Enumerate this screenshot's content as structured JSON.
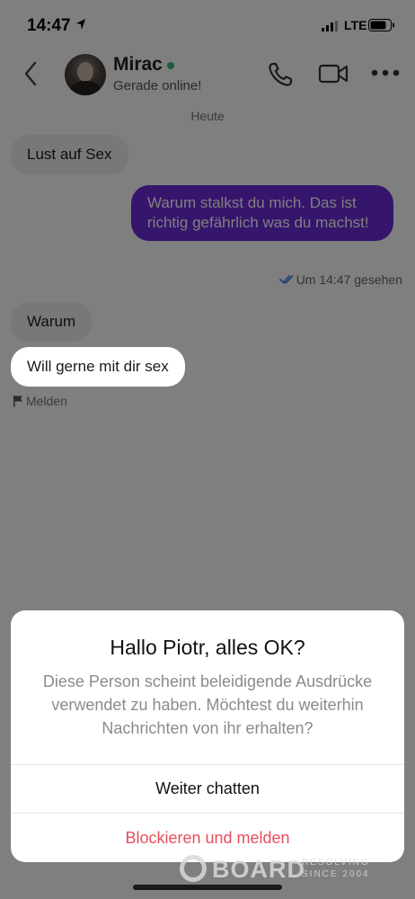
{
  "status_bar": {
    "time": "14:47",
    "network": "LTE"
  },
  "header": {
    "contact_name": "Mirac",
    "contact_status": "Gerade online!",
    "icons": [
      "chevron-left-icon",
      "phone-icon",
      "video-camera-icon",
      "more-icon"
    ]
  },
  "chat": {
    "day_label": "Heute",
    "messages": [
      {
        "direction": "incoming",
        "text": "Lust auf Sex"
      },
      {
        "direction": "outgoing",
        "text": "Warum stalkst du mich. Das ist richtig gefährlich was du machst!"
      },
      {
        "direction": "incoming",
        "text": "Warum"
      },
      {
        "direction": "incoming",
        "text": "Will gerne mit dir sex"
      }
    ],
    "seen_label": "Um 14:47 gesehen",
    "report_label": "Melden"
  },
  "dialog": {
    "title": "Hallo Piotr, alles OK?",
    "body": "Diese Person scheint beleidigende Ausdrücke verwendet zu haben. Möchtest du weiterhin Nachrichten von ihr erhalten?",
    "continue_label": "Weiter chatten",
    "block_label": "Blockieren und melden"
  },
  "watermark": {
    "brand": "BOARD",
    "tag_top": "RESOLVING",
    "tag_bottom": "SINCE 2004"
  },
  "colors": {
    "outgoing_bubble": "#6c2bd9",
    "online_dot": "#3fb977",
    "seen_check": "#3a86e0",
    "block_action": "#e84d5b"
  }
}
